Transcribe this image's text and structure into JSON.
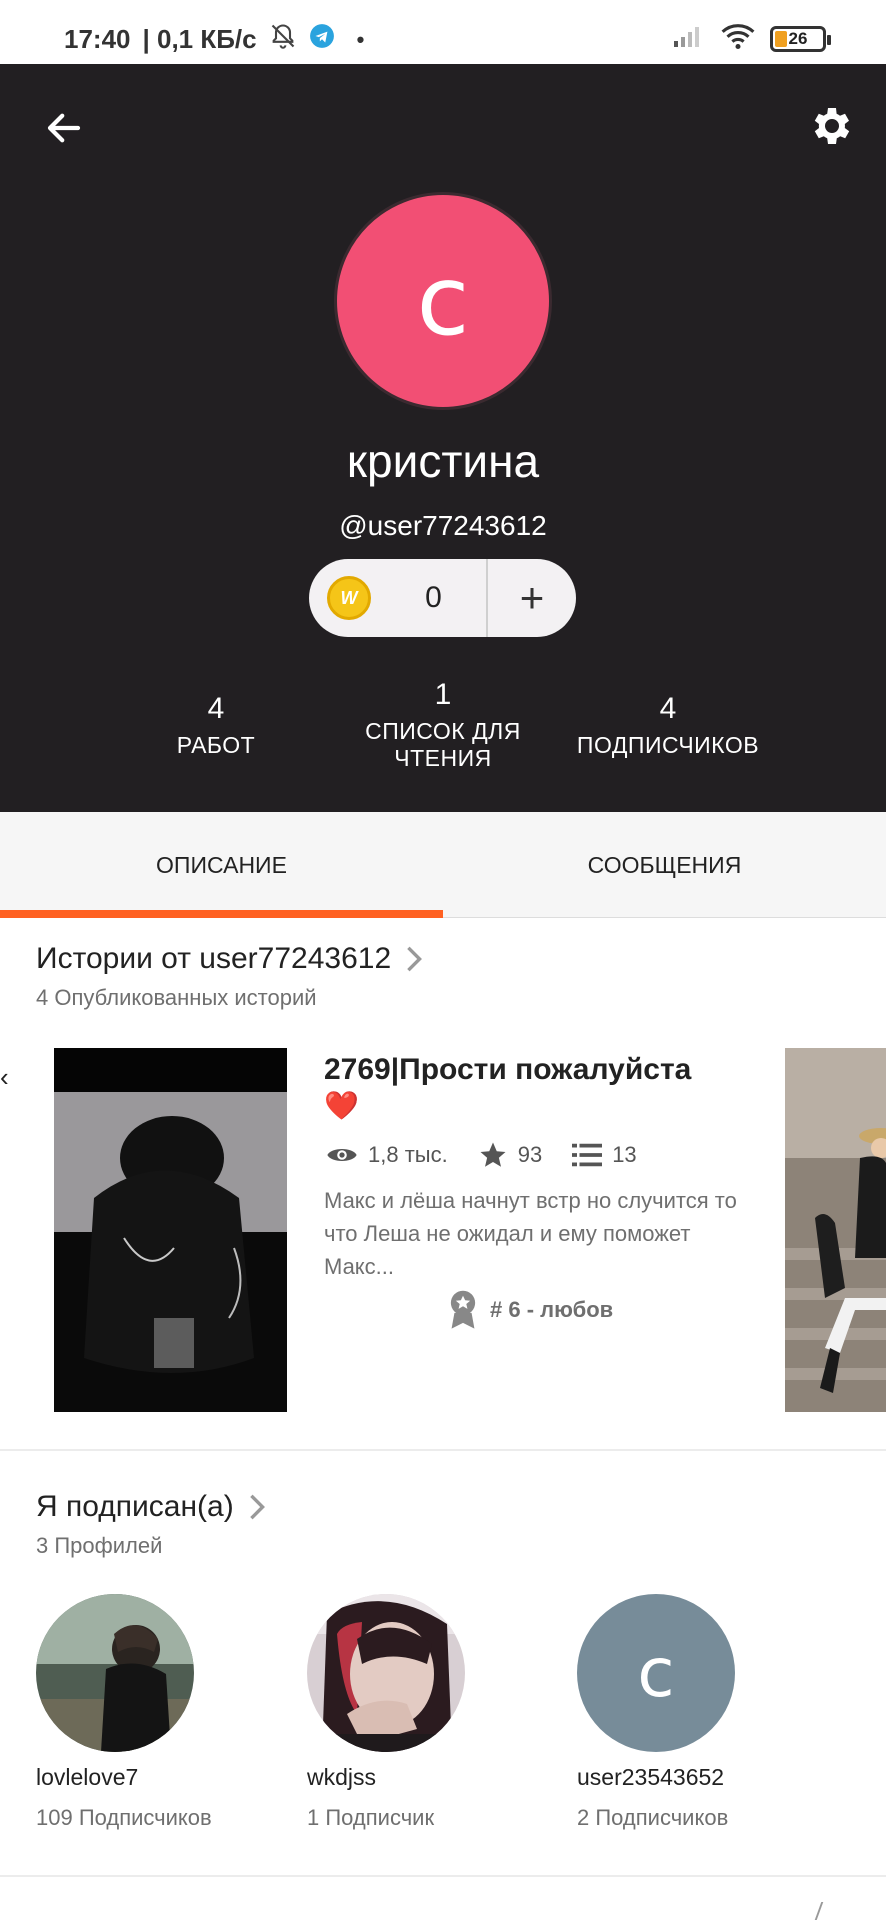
{
  "status_bar": {
    "time": "17:40",
    "speed": "| 0,1 КБ/с",
    "battery": "26",
    "icons": [
      "bell-off-icon",
      "telegram-icon",
      "signal-icon",
      "wifi-icon",
      "battery-icon"
    ]
  },
  "profile": {
    "avatar_letter": "c",
    "display_name": "кристина",
    "username": "@user77243612",
    "coins": "0",
    "coin_plus": "+",
    "stats": [
      {
        "num": "4",
        "label": "РАБОТ"
      },
      {
        "num": "1",
        "label": "СПИСОК ДЛЯ ЧТЕНИЯ"
      },
      {
        "num": "4",
        "label": "ПОДПИСЧИКОВ"
      }
    ],
    "colors": {
      "header_bg": "#221f22",
      "avatar_bg": "#f24f74",
      "accent": "#ff6122"
    }
  },
  "tabs": [
    {
      "label": "ОПИСАНИЕ",
      "active": true
    },
    {
      "label": "СООБЩЕНИЯ",
      "active": false
    }
  ],
  "stories": {
    "title": "Истории от user77243612",
    "subtitle": "4 Опубликованных историй",
    "items": [
      {
        "title": "2769|Прости пожалуйста",
        "emoji": "❤️",
        "views": "1,8 тыс.",
        "votes": "93",
        "parts": "13",
        "description": "Макс и лёша начнут встр но случится то что Леша не ожидал и ему поможет Макс...",
        "rank": "# 6 - любов"
      }
    ]
  },
  "following": {
    "title": "Я подписан(а)",
    "subtitle": "3 Профилей",
    "profiles": [
      {
        "name": "lovlelove7",
        "followers": "109 Подписчиков"
      },
      {
        "name": "wkdjss",
        "followers": "1 Подписчик"
      },
      {
        "name": "user23543652",
        "followers": "2 Подписчиков",
        "letter": "c"
      }
    ]
  }
}
